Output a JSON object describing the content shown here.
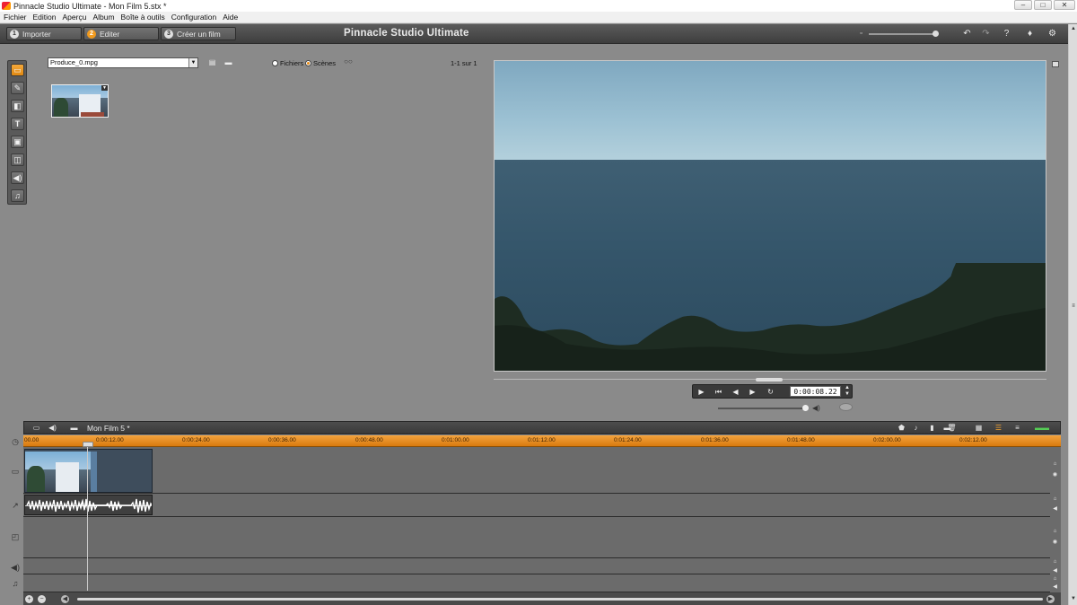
{
  "window": {
    "title": "Pinnacle Studio Ultimate - Mon Film 5.stx *",
    "controls": [
      "–",
      "□",
      "✕"
    ]
  },
  "menu": [
    "Fichier",
    "Edition",
    "Aperçu",
    "Album",
    "Boîte à outils",
    "Configuration",
    "Aide"
  ],
  "modes": [
    {
      "num": "1",
      "label": "Importer"
    },
    {
      "num": "2",
      "label": "Editer"
    },
    {
      "num": "3",
      "label": "Créer un film"
    }
  ],
  "brand": "Pinnacle Studio Ultimate",
  "album": {
    "source_file": "Produce_0.mpg",
    "view_options": [
      {
        "label": "Fichiers",
        "selected": false
      },
      {
        "label": "Scènes",
        "selected": true
      }
    ],
    "counter": "1-1 sur 1"
  },
  "player": {
    "timecode": "0:00:08.22"
  },
  "timeline": {
    "project_title": "Mon Film 5 *",
    "ruler_ticks": [
      "00.00",
      "0:00:12.00",
      "0:00:24.00",
      "0:00:36.00",
      "0:00:48.00",
      "0:01:00.00",
      "0:01:12.00",
      "0:01:24.00",
      "0:01:36.00",
      "0:01:48.00",
      "0:02:00.00",
      "0:02:12.00"
    ]
  },
  "icons": {
    "palette": [
      "video-clip-icon",
      "edit-icon",
      "transition-icon",
      "title-icon",
      "photo-icon",
      "menu-icon",
      "sound-icon",
      "music-icon"
    ]
  }
}
